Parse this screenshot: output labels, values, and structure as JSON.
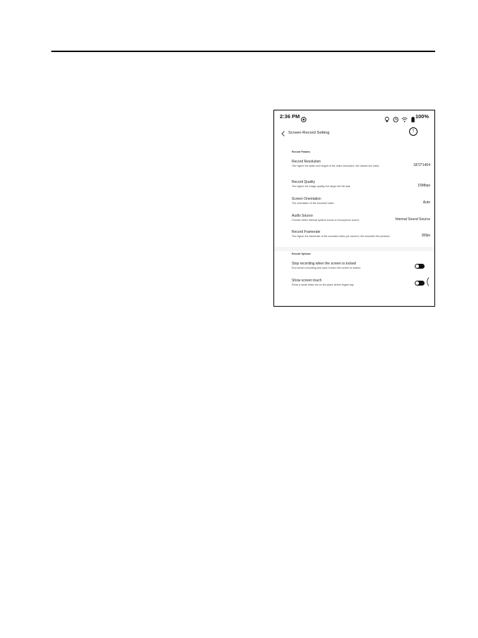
{
  "status_bar": {
    "time": "2:36 PM",
    "battery": "100%",
    "icons": [
      "sync-icon",
      "lightbulb-icon",
      "clock-icon",
      "wifi-icon",
      "battery-icon"
    ]
  },
  "header": {
    "title": "Screen-Record Setting"
  },
  "record_params": {
    "label": "Record Params",
    "items": [
      {
        "title": "Record Resolution",
        "desc": "The higher the width and height of the video resolution, the clearer the video.",
        "value": "1872*1404"
      },
      {
        "title": "Record Quality",
        "desc": "The higher the image quality, the larger the file size.",
        "value": "15Mbps"
      },
      {
        "title": "Screen Orientation",
        "desc": "The orientation of the recorded video",
        "value": "Auto"
      },
      {
        "title": "Audio Source",
        "desc": "Choose either internal system sound or microphone sound",
        "value": "Internal Sound Source"
      },
      {
        "title": "Record Framerate",
        "desc": "The higher the framerate of the recorded video per second, the smoother the pictures.",
        "value": "30fps"
      }
    ]
  },
  "record_options": {
    "label": "Record Options",
    "items": [
      {
        "title": "Stop recording when the screen is locked",
        "desc": "End screen recording and save it when the screen is locked.",
        "enabled": true
      },
      {
        "title": "Show screen touch",
        "desc": "Show a small white dot on the place where fingers tap",
        "enabled": true
      }
    ]
  }
}
